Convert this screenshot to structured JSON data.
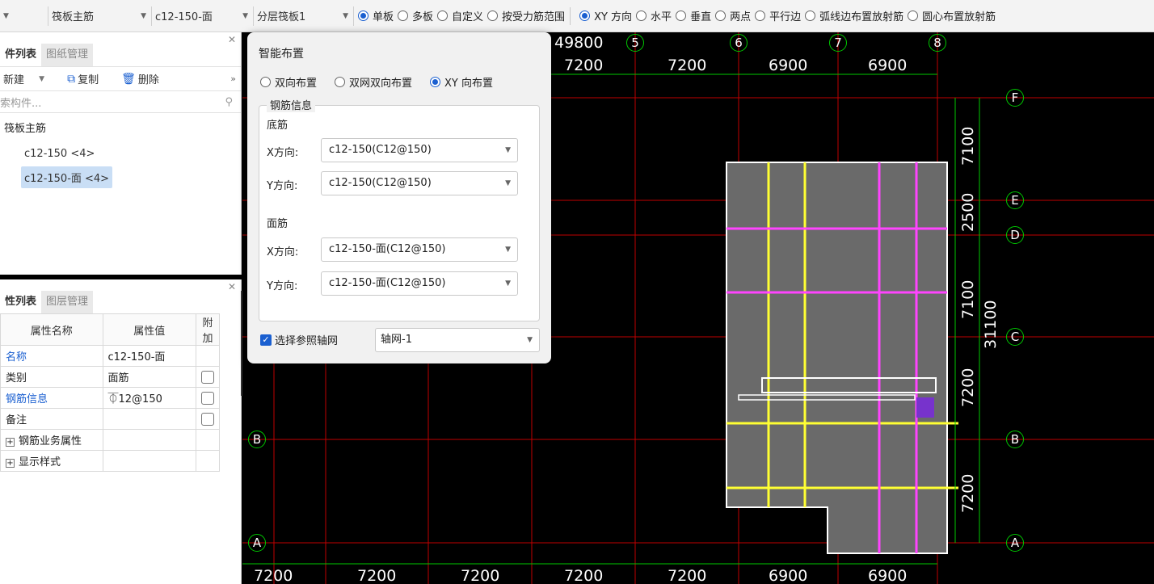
{
  "toolbar": {
    "select_first": "",
    "select_type": "筏板主筋",
    "select_rebar": "c12-150-面",
    "select_layer": "分层筏板1",
    "radios": [
      {
        "label": "单板",
        "checked": true
      },
      {
        "label": "多板",
        "checked": false
      },
      {
        "label": "自定义",
        "checked": false
      },
      {
        "label": "按受力筋范围",
        "checked": false
      },
      {
        "label": "XY 方向",
        "checked": true
      },
      {
        "label": "水平",
        "checked": false
      },
      {
        "label": "垂直",
        "checked": false
      },
      {
        "label": "两点",
        "checked": false
      },
      {
        "label": "平行边",
        "checked": false
      },
      {
        "label": "弧线边布置放射筋",
        "checked": false
      },
      {
        "label": "圆心布置放射筋",
        "checked": false
      }
    ]
  },
  "component_panel": {
    "tab_active": "件列表",
    "tab_inactive": "图纸管理",
    "new_label": "新建",
    "copy_label": "复制",
    "delete_label": "删除",
    "more": "»",
    "search_placeholder": "索构件...",
    "tree_root": "筏板主筋",
    "items": [
      "c12-150 <4>",
      "c12-150-面 <4>"
    ]
  },
  "property_panel": {
    "tab_active": "性列表",
    "tab_inactive": "图层管理",
    "col_name": "属性名称",
    "col_value": "属性值",
    "col_extra": "附加",
    "rows": [
      {
        "name": "名称",
        "value": "c12-150-面",
        "blue": true,
        "check": false
      },
      {
        "name": "类别",
        "value": "面筋",
        "blue": false,
        "check": true
      },
      {
        "name": "钢筋信息",
        "value": "⏁12@150",
        "blue": true,
        "check": true
      },
      {
        "name": "备注",
        "value": "",
        "blue": false,
        "check": true
      }
    ],
    "groups": [
      "钢筋业务属性",
      "显示样式"
    ]
  },
  "dialog": {
    "title": "智能布置",
    "options": [
      {
        "label": "双向布置",
        "checked": false
      },
      {
        "label": "双网双向布置",
        "checked": false
      },
      {
        "label": "XY 向布置",
        "checked": true
      }
    ],
    "group_title": "钢筋信息",
    "bottom_title": "底筋",
    "top_title": "面筋",
    "x_label": "X方向:",
    "y_label": "Y方向:",
    "bottom_x": "c12-150(C12@150)",
    "bottom_y": "c12-150(C12@150)",
    "top_x": "c12-150-面(C12@150)",
    "top_y": "c12-150-面(C12@150)",
    "ref_label": "选择参照轴网",
    "ref_value": "轴网-1"
  },
  "canvas": {
    "total_top": "49800",
    "axis_top": [
      "5",
      "6",
      "7",
      "8"
    ],
    "dims_top": [
      "7200",
      "7200",
      "6900",
      "6900"
    ],
    "axis_right": [
      "F",
      "E",
      "D",
      "C",
      "B",
      "A"
    ],
    "dims_right": [
      "7100",
      "2500",
      "7100",
      "7200",
      "7200"
    ],
    "total_right": "31100",
    "axis_left": [
      "B",
      "A"
    ],
    "dims_bottom": [
      "7200",
      "7200",
      "7200",
      "7200",
      "7200",
      "6900",
      "6900"
    ]
  }
}
